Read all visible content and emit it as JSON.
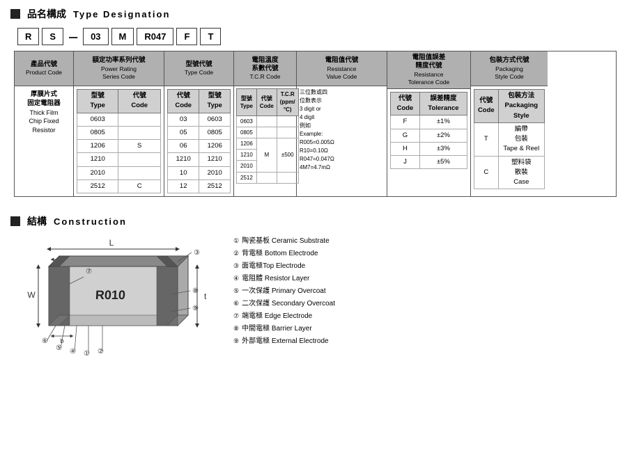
{
  "section1": {
    "icon": "■",
    "title_jp": "品名構成",
    "title_en": "Type Designation"
  },
  "top_codes": {
    "codes": [
      "R",
      "S",
      "-",
      "03",
      "M",
      "R047",
      "F",
      "T"
    ]
  },
  "columns": {
    "product": {
      "header_jp": "產品代號",
      "header_en": "Product Code",
      "body_jp": "厚膜片式\n固定電阻器",
      "body_en1": "Thick Film",
      "body_en2": "Chip Fixed",
      "body_en3": "Resistor"
    },
    "power": {
      "header_jp": "額定功率系列代號",
      "header_en": "Power Rating Series Code",
      "col1": "型號 Type",
      "col2": "代號 Code",
      "rows": [
        [
          "0603",
          ""
        ],
        [
          "0805",
          ""
        ],
        [
          "1206",
          "S"
        ],
        [
          "1210",
          ""
        ],
        [
          "2010",
          ""
        ],
        [
          "2512",
          "C"
        ]
      ]
    },
    "type": {
      "header_jp": "型號代號",
      "header_en": "Type Code",
      "col1": "代號 Code",
      "col2": "型號 Type",
      "rows": [
        [
          "03",
          "0603"
        ],
        [
          "05",
          "0805"
        ],
        [
          "06",
          "1206"
        ],
        [
          "1210",
          "1210"
        ],
        [
          "10",
          "2010"
        ],
        [
          "12",
          "2512"
        ]
      ]
    },
    "tcr": {
      "header_jp": "電阻溫度\n系數代號",
      "header_en": "T.C.R Code",
      "col1": "型號 Type",
      "col2": "代號 Code",
      "col3": "T.C.R (ppm/°C)",
      "rows": [
        [
          "0603",
          "",
          ""
        ],
        [
          "0805",
          "",
          ""
        ],
        [
          "1206",
          "M",
          "±500"
        ],
        [
          "1210",
          "",
          ""
        ],
        [
          "2010",
          "",
          ""
        ],
        [
          "2512",
          "",
          ""
        ]
      ],
      "note": "M  ±500"
    },
    "resistance": {
      "header_jp": "電阻值代號",
      "header_en": "Resistance Value Code",
      "desc1": "三位數或四",
      "desc2": "位數表示",
      "desc3": "3 digit or",
      "desc4": "4 digit",
      "desc5": "例如",
      "desc6": "Example:",
      "examples": [
        "R005=0.005Ω",
        "R10=0.10Ω",
        "R047=0.047Ω",
        "4M7=4.7mΩ"
      ]
    },
    "tolerance": {
      "header_jp": "電阻值誤差\n精度代號",
      "header_en1": "Resistance",
      "header_en2": "Tolerance Code",
      "col1": "代號 Code",
      "col2": "誤差精度 Tolerance",
      "rows": [
        [
          "F",
          "±1%"
        ],
        [
          "G",
          "±2%"
        ],
        [
          "H",
          "±3%"
        ],
        [
          "J",
          "±5%"
        ]
      ]
    },
    "packaging": {
      "header_jp": "包裝方式代號",
      "header_en": "Packaging Style Code",
      "col1": "代號 Code",
      "col2": "包裝方法 Packaging Style",
      "rows": [
        [
          "T",
          "編帶包裝\nTape & Reel"
        ],
        [
          "C",
          "塑料袋散裝\nCase"
        ]
      ]
    }
  },
  "section2": {
    "icon": "■",
    "title_jp": "結構",
    "title_en": "Construction"
  },
  "construction_items": [
    {
      "num": "①",
      "text": "陶瓷基板 Ceramic Substrate"
    },
    {
      "num": "②",
      "text": "背電極 Bottom Electrode"
    },
    {
      "num": "③",
      "text": "面電極Top Electrode"
    },
    {
      "num": "④",
      "text": "電阻體 Resistor Layer"
    },
    {
      "num": "⑤",
      "text": "一次保護 Primary Overcoat"
    },
    {
      "num": "⑥",
      "text": "二次保護 Secondary Overcoat"
    },
    {
      "num": "⑦",
      "text": "端電極 Edge Electrode"
    },
    {
      "num": "⑧",
      "text": "中間電極 Barrier Layer"
    },
    {
      "num": "⑨",
      "text": "外部電極 External Electrode"
    }
  ]
}
